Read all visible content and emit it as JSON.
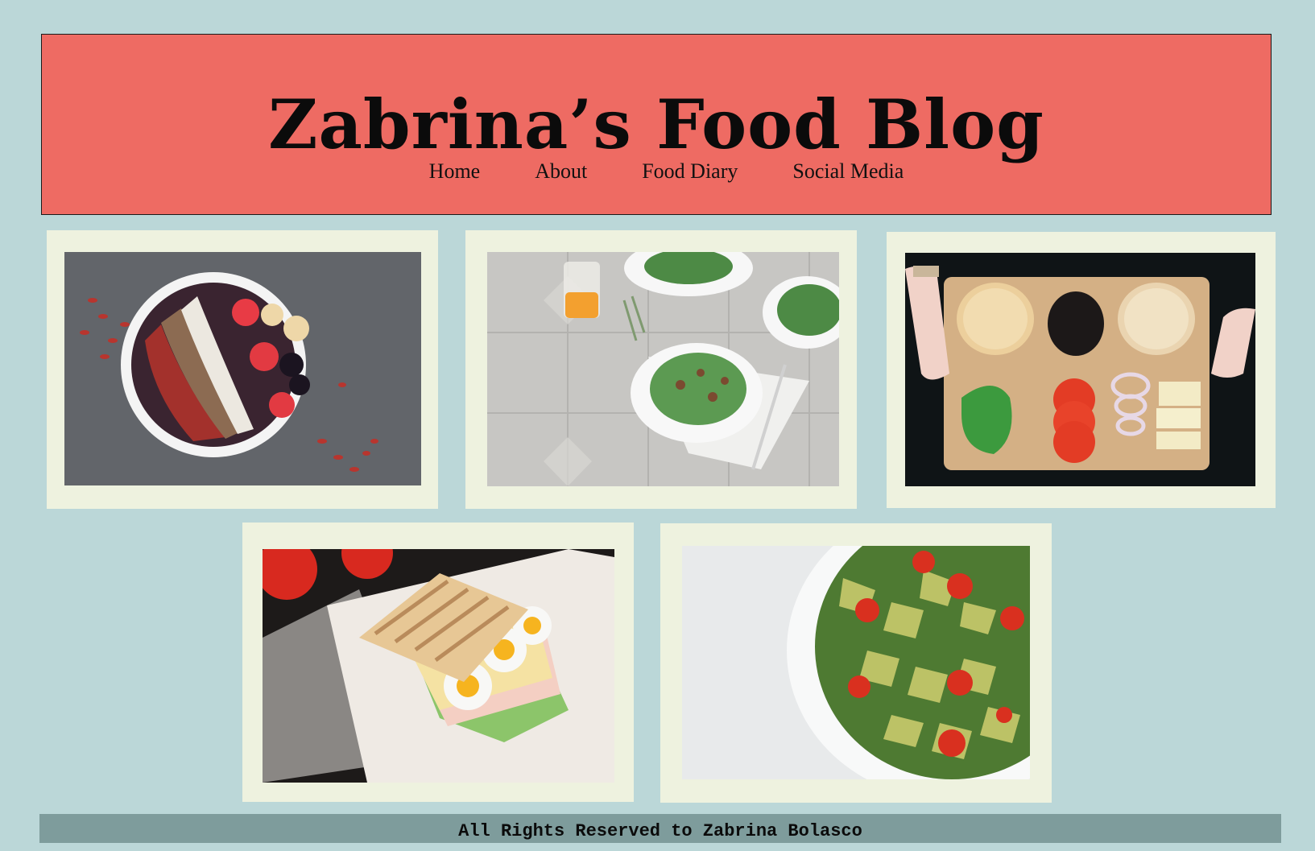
{
  "header": {
    "title": "Zabrina’s Food Blog",
    "nav": [
      {
        "label": "Home"
      },
      {
        "label": "About"
      },
      {
        "label": "Food Diary"
      },
      {
        "label": "Social Media"
      }
    ]
  },
  "gallery": [
    {
      "icon": "acai-bowl-photo"
    },
    {
      "icon": "salad-plates-photo"
    },
    {
      "icon": "burger-ingredients-board-photo"
    },
    {
      "icon": "egg-ham-sandwich-photo"
    },
    {
      "icon": "pesto-pasta-salad-photo"
    }
  ],
  "footer": {
    "text": "All Rights Reserved to Zabrina Bolasco"
  },
  "colors": {
    "page_background": "#bbd7d8",
    "header_background": "#ee6b63",
    "card_background": "#eef2df",
    "footer_background": "#7e9c9c"
  }
}
